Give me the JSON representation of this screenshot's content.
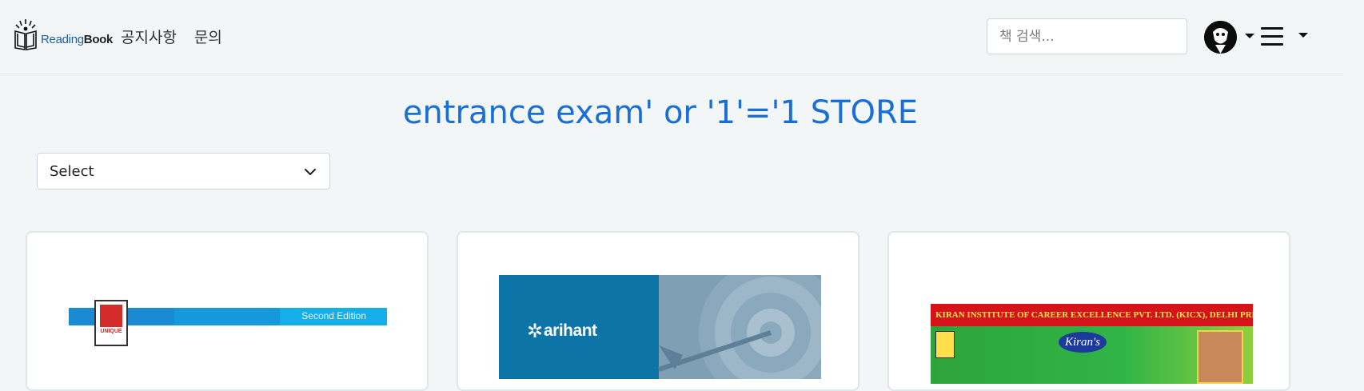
{
  "brand": {
    "reading": "Reading",
    "book": "Book"
  },
  "nav": {
    "items": [
      {
        "label": "공지사항"
      },
      {
        "label": "문의"
      }
    ]
  },
  "search": {
    "placeholder": "책 검색..."
  },
  "title": "entrance exam' or '1'='1 STORE",
  "select": {
    "selected": "Select"
  },
  "icons": {
    "logo": "open-book-icon",
    "avatar": "user-avatar",
    "menu": "hamburger-menu-icon",
    "dropdown": "caret-down-icon",
    "select_chevron": "chevron-down-icon"
  },
  "colors": {
    "title": "#1a6fd6",
    "background": "#f3f6f6",
    "brand_blue": "#1f5f9f"
  },
  "books": [
    {
      "cover_text": {
        "edition": "Second Edition",
        "logo": "UNIQUE"
      }
    },
    {
      "cover_text": {
        "publisher": "arihant"
      }
    },
    {
      "cover_text": {
        "header": "KIRAN INSTITUTE OF CAREER EXCELLENCE PVT. LTD. (KICX), DELHI PRESENTS",
        "brand": "Kiran's"
      }
    }
  ]
}
